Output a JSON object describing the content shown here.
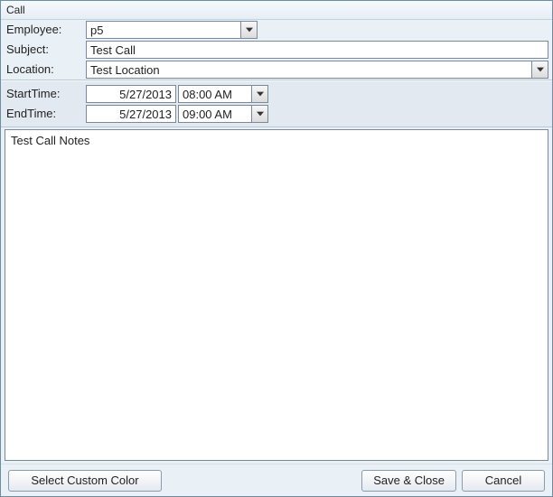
{
  "title": "Call",
  "labels": {
    "employee": "Employee:",
    "subject": "Subject:",
    "location": "Location:",
    "start": "StartTime:",
    "end": "EndTime:"
  },
  "fields": {
    "employee": "p5",
    "subject": "Test Call",
    "location": "Test Location",
    "startDate": "5/27/2013",
    "startTime": "08:00 AM",
    "endDate": "5/27/2013",
    "endTime": "09:00 AM",
    "notes": "Test Call Notes"
  },
  "buttons": {
    "customColor": "Select Custom Color",
    "save": "Save & Close",
    "cancel": "Cancel"
  }
}
